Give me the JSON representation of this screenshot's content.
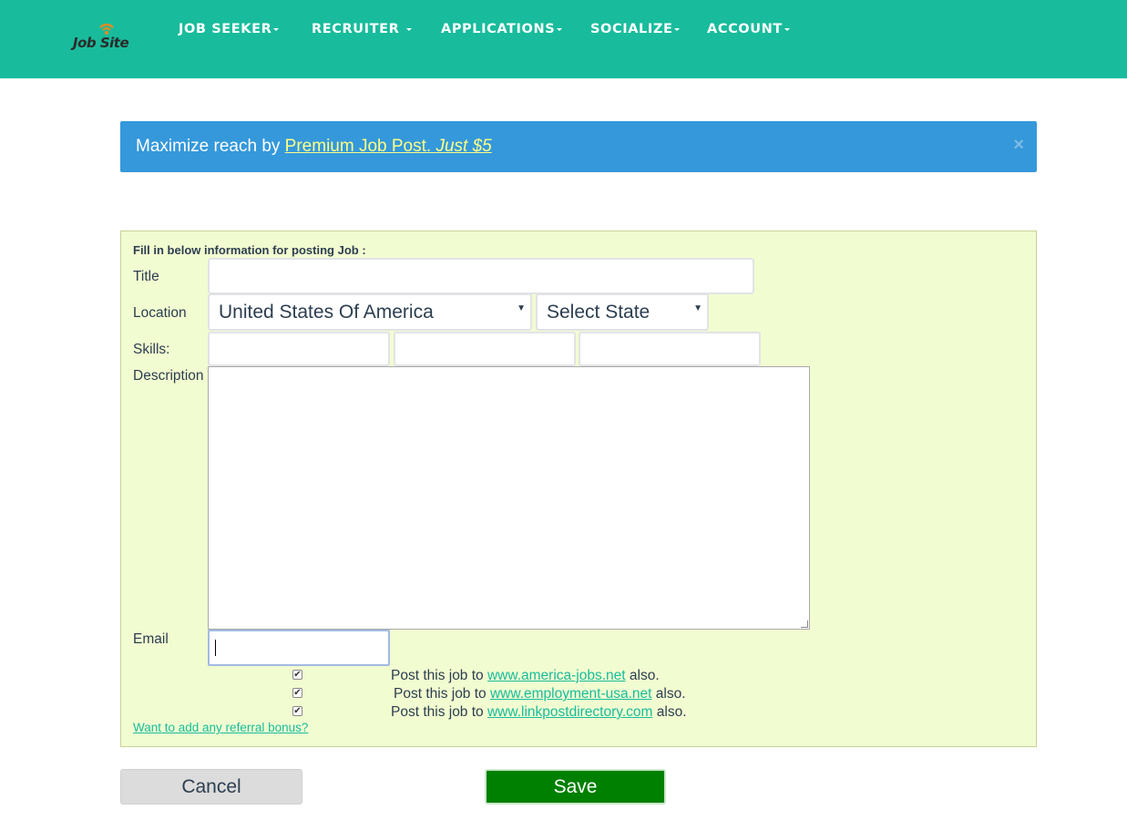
{
  "nav": {
    "logo_text": "Job Site",
    "items": [
      {
        "label": "JOB SEEKER"
      },
      {
        "label": "RECRUITER "
      },
      {
        "label": "APPLICATIONS"
      },
      {
        "label": "SOCIALIZE"
      },
      {
        "label": "ACCOUNT"
      }
    ]
  },
  "alert": {
    "prefix": "Maximize reach by ",
    "link_main": "Premium Job Post.",
    "link_em": "Just $5",
    "close": "×"
  },
  "form": {
    "heading": "Fill in below information for posting Job :",
    "title_label": "Title",
    "location_label": "Location",
    "country_value": "United States Of America",
    "state_value": "Select State",
    "skills_label": "Skills:",
    "description_label": "Description",
    "email_label": "Email",
    "post_lines": [
      {
        "prefix": "Post this job to ",
        "link": "www.america-jobs.net",
        "suffix": " also.",
        "checked": true
      },
      {
        "prefix": "Post this job to ",
        "link": "www.employment-usa.net",
        "suffix": " also.",
        "checked": true
      },
      {
        "prefix": "Post this job to ",
        "link": "www.linkpostdirectory.com",
        "suffix": " also.",
        "checked": true
      }
    ],
    "referral": "Want to add any referral bonus?"
  },
  "buttons": {
    "cancel": "Cancel",
    "save": "Save"
  },
  "colors": {
    "navbar": "#18bc9c",
    "alert": "#3498db",
    "form_bg": "#f2fcd1",
    "save": "#008000",
    "link": "#18bc9c"
  },
  "icons": {
    "logo": "job-site-logo",
    "select_arrow": "dropdown-arrow-icon",
    "close": "close-icon",
    "checkbox": "checkmark-icon"
  }
}
